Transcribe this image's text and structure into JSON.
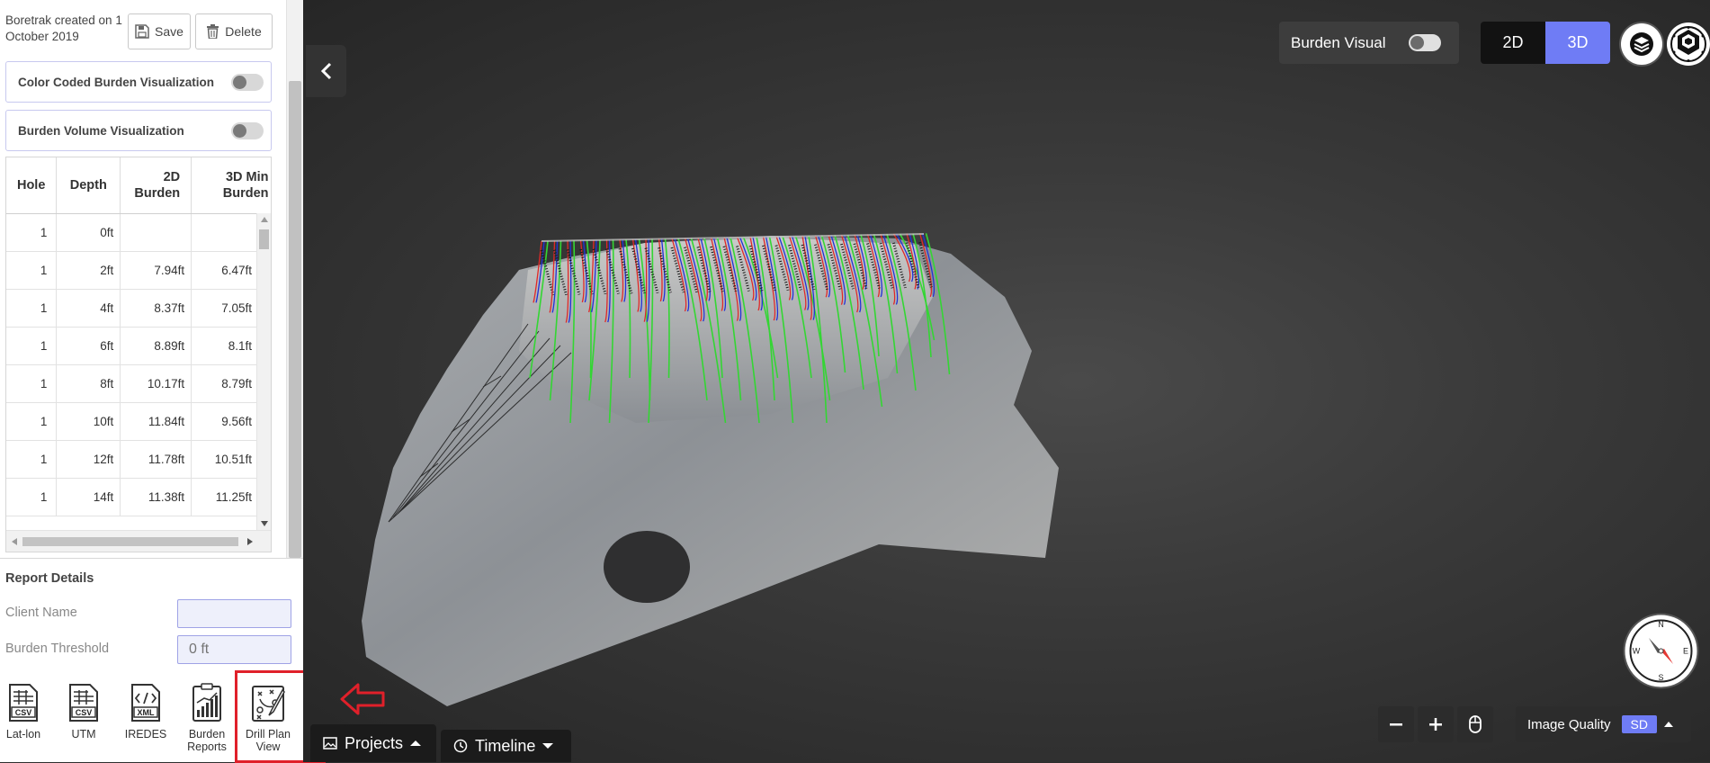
{
  "left_panel": {
    "created_text": "Boretrak created on 1 October 2019",
    "save_label": "Save",
    "delete_label": "Delete",
    "toggles": [
      {
        "label": "Color Coded Burden Visualization",
        "enabled": false
      },
      {
        "label": "Burden Volume Visualization",
        "enabled": false
      }
    ],
    "table": {
      "headers": [
        "Hole",
        "Depth",
        "2D Burden",
        "3D Min Burden"
      ],
      "rows": [
        [
          "1",
          "0ft",
          "",
          ""
        ],
        [
          "1",
          "2ft",
          "7.94ft",
          "6.47ft"
        ],
        [
          "1",
          "4ft",
          "8.37ft",
          "7.05ft"
        ],
        [
          "1",
          "6ft",
          "8.89ft",
          "8.1ft"
        ],
        [
          "1",
          "8ft",
          "10.17ft",
          "8.79ft"
        ],
        [
          "1",
          "10ft",
          "11.84ft",
          "9.56ft"
        ],
        [
          "1",
          "12ft",
          "11.78ft",
          "10.51ft"
        ],
        [
          "1",
          "14ft",
          "11.38ft",
          "11.25ft"
        ]
      ]
    },
    "report": {
      "title": "Report Details",
      "client_name_label": "Client Name",
      "client_name_value": "",
      "burden_threshold_label": "Burden Threshold",
      "burden_threshold_placeholder": "0 ft"
    },
    "exports": [
      {
        "label": "Lat-lon",
        "icon": "csv-file-icon",
        "badge": "CSV"
      },
      {
        "label": "UTM",
        "icon": "csv-file-icon",
        "badge": "CSV"
      },
      {
        "label": "IREDES",
        "icon": "xml-file-icon",
        "badge": "XML"
      },
      {
        "label": "Burden Reports",
        "icon": "report-chart-icon"
      },
      {
        "label": "Drill Plan View",
        "icon": "drill-plan-icon"
      }
    ]
  },
  "viewport": {
    "burden_visual_label": "Burden Visual",
    "burden_visual_enabled": false,
    "view_modes": [
      "2D",
      "3D"
    ],
    "active_view_mode": "3D",
    "image_quality_label": "Image Quality",
    "image_quality_value": "SD",
    "compass": {
      "n": "N",
      "e": "E",
      "s": "S",
      "w": "W"
    },
    "tabs": {
      "projects": "Projects",
      "timeline": "Timeline"
    }
  },
  "colors": {
    "accent": "#6f7cf5",
    "highlight": "#e0202a",
    "hole_green": "#33d633",
    "hole_blue": "#2030d8",
    "hole_red": "#e02828"
  }
}
